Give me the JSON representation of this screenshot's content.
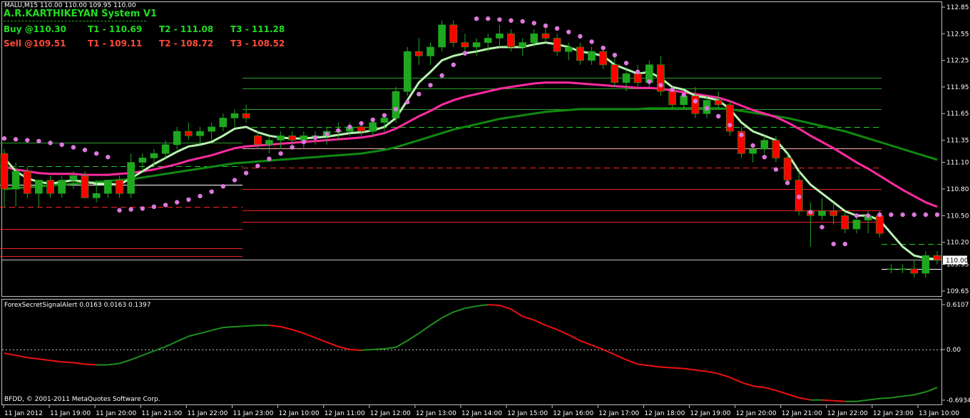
{
  "header": {
    "symbol_line": "MALU,M15  110.00 110.00 109.95 110.00",
    "system_name": "A.R.KARTHIKEYAN System V1",
    "buy": {
      "entry": "Buy @110.30",
      "t1": "T1 - 110.69",
      "t2": "T2 - 111.08",
      "t3": "T3 - 111.28"
    },
    "sell": {
      "entry": "Sell @109.51",
      "t1": "T1 - 109.11",
      "t2": "T2 - 108.72",
      "t3": "T3 - 108.52"
    }
  },
  "indicator": {
    "label": "ForexSecretSignalAlert 0.0163 0.0163 0.1397"
  },
  "copyright": "BFDD, © 2001-2011 MetaQuotes Software Corp.",
  "colors": {
    "bull": "#1fa81f",
    "bear": "#ff0000",
    "ema_fast": "#b8f5b0",
    "ema_mid": "#ff2ba0",
    "ema_slow": "#0f8a0f",
    "psar": "#dd77dd"
  },
  "chart_data": {
    "type": "line",
    "price_axis": [
      "112.85",
      "112.55",
      "112.25",
      "111.95",
      "111.65",
      "111.35",
      "111.10",
      "110.80",
      "110.50",
      "110.20",
      "109.95",
      "109.65"
    ],
    "price_values": [
      112.85,
      112.55,
      112.25,
      111.95,
      111.65,
      111.35,
      111.1,
      110.8,
      110.5,
      110.2,
      109.95,
      109.65
    ],
    "current_price": "110.00",
    "ylim": [
      109.55,
      112.92
    ],
    "time_axis": [
      "11 Jan 2012",
      "11 Jan 19:00",
      "11 Jan 20:00",
      "11 Jan 21:00",
      "11 Jan 22:00",
      "11 Jan 23:00",
      "12 Jan 10:00",
      "12 Jan 11:00",
      "12 Jan 12:00",
      "12 Jan 13:00",
      "12 Jan 14:00",
      "12 Jan 15:00",
      "12 Jan 16:00",
      "12 Jan 17:00",
      "12 Jan 18:00",
      "12 Jan 19:00",
      "12 Jan 20:00",
      "12 Jan 21:00",
      "12 Jan 22:00",
      "12 Jan 23:00",
      "13 Jan 10:00"
    ],
    "indicator_axis": [
      "0.6107",
      "0.00",
      "-0.6934"
    ],
    "indicator_values": [
      0.6107,
      0.0,
      -0.6934
    ],
    "candles": [
      [
        111.2,
        111.25,
        110.6,
        110.8
      ],
      [
        110.8,
        111.1,
        110.6,
        111.0
      ],
      [
        111.0,
        111.05,
        110.7,
        110.75
      ],
      [
        110.75,
        110.9,
        110.6,
        110.9
      ],
      [
        110.9,
        110.95,
        110.7,
        110.75
      ],
      [
        110.75,
        110.95,
        110.7,
        110.9
      ],
      [
        110.9,
        111.0,
        110.8,
        110.95
      ],
      [
        110.95,
        111.0,
        110.7,
        110.7
      ],
      [
        110.7,
        110.9,
        110.65,
        110.75
      ],
      [
        110.75,
        110.9,
        110.7,
        110.9
      ],
      [
        110.9,
        110.95,
        110.7,
        110.75
      ],
      [
        110.75,
        111.2,
        110.7,
        111.1
      ],
      [
        111.1,
        111.2,
        111.0,
        111.15
      ],
      [
        111.15,
        111.25,
        111.05,
        111.2
      ],
      [
        111.2,
        111.35,
        111.15,
        111.3
      ],
      [
        111.3,
        111.5,
        111.25,
        111.45
      ],
      [
        111.45,
        111.55,
        111.35,
        111.4
      ],
      [
        111.4,
        111.5,
        111.3,
        111.45
      ],
      [
        111.45,
        111.55,
        111.35,
        111.5
      ],
      [
        111.5,
        111.65,
        111.45,
        111.6
      ],
      [
        111.6,
        111.7,
        111.5,
        111.65
      ],
      [
        111.65,
        111.75,
        111.55,
        111.6
      ],
      [
        111.4,
        111.45,
        111.25,
        111.3
      ],
      [
        111.3,
        111.4,
        111.2,
        111.35
      ],
      [
        111.35,
        111.45,
        111.25,
        111.4
      ],
      [
        111.4,
        111.45,
        111.3,
        111.35
      ],
      [
        111.35,
        111.45,
        111.25,
        111.4
      ],
      [
        111.4,
        111.45,
        111.3,
        111.4
      ],
      [
        111.4,
        111.5,
        111.3,
        111.45
      ],
      [
        111.45,
        111.55,
        111.35,
        111.45
      ],
      [
        111.45,
        111.55,
        111.4,
        111.5
      ],
      [
        111.5,
        111.55,
        111.4,
        111.45
      ],
      [
        111.45,
        111.6,
        111.4,
        111.55
      ],
      [
        111.55,
        111.65,
        111.45,
        111.6
      ],
      [
        111.6,
        111.95,
        111.55,
        111.9
      ],
      [
        111.9,
        112.4,
        111.85,
        112.35
      ],
      [
        112.35,
        112.5,
        112.2,
        112.3
      ],
      [
        112.3,
        112.45,
        112.2,
        112.4
      ],
      [
        112.4,
        112.7,
        112.35,
        112.65
      ],
      [
        112.65,
        112.7,
        112.4,
        112.45
      ],
      [
        112.45,
        112.55,
        112.3,
        112.4
      ],
      [
        112.4,
        112.5,
        112.3,
        112.45
      ],
      [
        112.45,
        112.55,
        112.35,
        112.5
      ],
      [
        112.5,
        112.65,
        112.4,
        112.55
      ],
      [
        112.55,
        112.6,
        112.35,
        112.4
      ],
      [
        112.4,
        112.5,
        112.3,
        112.45
      ],
      [
        112.45,
        112.6,
        112.4,
        112.55
      ],
      [
        112.55,
        112.65,
        112.45,
        112.5
      ],
      [
        112.5,
        112.55,
        112.3,
        112.35
      ],
      [
        112.35,
        112.45,
        112.25,
        112.4
      ],
      [
        112.4,
        112.45,
        112.2,
        112.25
      ],
      [
        112.25,
        112.4,
        112.2,
        112.35
      ],
      [
        112.35,
        112.4,
        112.15,
        112.2
      ],
      [
        112.2,
        112.3,
        111.95,
        112.0
      ],
      [
        112.0,
        112.15,
        111.9,
        112.1
      ],
      [
        112.1,
        112.2,
        111.95,
        112.0
      ],
      [
        112.0,
        112.25,
        111.95,
        112.2
      ],
      [
        112.2,
        112.3,
        111.85,
        111.9
      ],
      [
        111.9,
        111.95,
        111.7,
        111.75
      ],
      [
        111.75,
        111.9,
        111.7,
        111.85
      ],
      [
        111.85,
        111.95,
        111.6,
        111.65
      ],
      [
        111.65,
        111.85,
        111.6,
        111.8
      ],
      [
        111.8,
        111.9,
        111.7,
        111.75
      ],
      [
        111.75,
        111.8,
        111.4,
        111.45
      ],
      [
        111.45,
        111.5,
        111.15,
        111.2
      ],
      [
        111.2,
        111.3,
        111.1,
        111.25
      ],
      [
        111.25,
        111.4,
        111.2,
        111.35
      ],
      [
        111.35,
        111.4,
        111.1,
        111.15
      ],
      [
        111.15,
        111.2,
        110.85,
        110.9
      ],
      [
        110.9,
        111.0,
        110.5,
        110.55
      ],
      [
        110.55,
        110.65,
        110.15,
        110.5
      ],
      [
        110.5,
        110.7,
        110.45,
        110.55
      ],
      [
        110.55,
        110.65,
        110.4,
        110.5
      ],
      [
        110.5,
        110.55,
        110.3,
        110.35
      ],
      [
        110.35,
        110.5,
        110.3,
        110.45
      ],
      [
        110.45,
        110.55,
        110.3,
        110.5
      ],
      [
        110.5,
        110.55,
        110.25,
        110.3
      ],
      [
        109.9,
        109.95,
        109.85,
        109.9
      ],
      [
        109.9,
        109.95,
        109.85,
        109.9
      ],
      [
        109.9,
        110.0,
        109.8,
        109.85
      ],
      [
        109.85,
        110.1,
        109.8,
        110.05
      ],
      [
        110.05,
        110.1,
        109.95,
        110.0
      ]
    ],
    "ema_fast": [
      111.15,
      111.0,
      110.92,
      110.88,
      110.86,
      110.88,
      110.9,
      110.88,
      110.86,
      110.86,
      110.85,
      110.92,
      111.0,
      111.08,
      111.15,
      111.22,
      111.28,
      111.3,
      111.33,
      111.4,
      111.48,
      111.5,
      111.44,
      111.4,
      111.38,
      111.37,
      111.37,
      111.38,
      111.39,
      111.41,
      111.43,
      111.44,
      111.46,
      111.5,
      111.6,
      111.8,
      112.0,
      112.12,
      112.25,
      112.3,
      112.33,
      112.35,
      112.38,
      112.4,
      112.4,
      112.4,
      112.43,
      112.45,
      112.43,
      112.4,
      112.35,
      112.33,
      112.3,
      112.2,
      112.15,
      112.1,
      112.12,
      112.05,
      111.95,
      111.92,
      111.85,
      111.83,
      111.8,
      111.7,
      111.55,
      111.45,
      111.4,
      111.35,
      111.2,
      111.0,
      110.85,
      110.75,
      110.65,
      110.55,
      110.5,
      110.5,
      110.45,
      110.3,
      110.15,
      110.05,
      110.02,
      110.01
    ],
    "ema_mid": [
      111.05,
      111.02,
      111.0,
      110.98,
      110.97,
      110.97,
      110.97,
      110.96,
      110.96,
      110.96,
      110.97,
      110.98,
      111.0,
      111.02,
      111.05,
      111.08,
      111.12,
      111.15,
      111.18,
      111.22,
      111.26,
      111.28,
      111.29,
      111.3,
      111.31,
      111.32,
      111.33,
      111.34,
      111.35,
      111.36,
      111.37,
      111.38,
      111.4,
      111.43,
      111.48,
      111.55,
      111.62,
      111.68,
      111.75,
      111.8,
      111.84,
      111.87,
      111.9,
      111.93,
      111.95,
      111.97,
      111.99,
      112.0,
      112.0,
      112.0,
      111.99,
      111.98,
      111.97,
      111.96,
      111.95,
      111.94,
      111.94,
      111.93,
      111.91,
      111.89,
      111.87,
      111.85,
      111.83,
      111.79,
      111.74,
      111.69,
      111.65,
      111.61,
      111.55,
      111.48,
      111.4,
      111.33,
      111.26,
      111.18,
      111.1,
      111.03,
      110.95,
      110.87,
      110.79,
      110.72,
      110.65,
      110.6
    ],
    "ema_slow": [
      110.8,
      110.81,
      110.82,
      110.83,
      110.84,
      110.85,
      110.86,
      110.87,
      110.88,
      110.89,
      110.9,
      110.91,
      110.93,
      110.95,
      110.97,
      110.99,
      111.01,
      111.03,
      111.05,
      111.07,
      111.09,
      111.1,
      111.11,
      111.12,
      111.13,
      111.14,
      111.15,
      111.16,
      111.17,
      111.18,
      111.19,
      111.2,
      111.22,
      111.24,
      111.27,
      111.31,
      111.35,
      111.39,
      111.43,
      111.47,
      111.5,
      111.53,
      111.56,
      111.59,
      111.61,
      111.63,
      111.65,
      111.67,
      111.68,
      111.69,
      111.7,
      111.7,
      111.7,
      111.7,
      111.7,
      111.7,
      111.71,
      111.71,
      111.71,
      111.71,
      111.71,
      111.71,
      111.71,
      111.7,
      111.68,
      111.66,
      111.64,
      111.62,
      111.6,
      111.57,
      111.54,
      111.51,
      111.48,
      111.45,
      111.41,
      111.37,
      111.33,
      111.29,
      111.25,
      111.21,
      111.17,
      111.13
    ],
    "psar": [
      111.37,
      111.36,
      111.35,
      111.34,
      111.32,
      111.3,
      111.27,
      111.24,
      111.2,
      111.16,
      110.56,
      110.57,
      110.58,
      110.6,
      110.62,
      110.65,
      110.68,
      110.72,
      110.77,
      110.83,
      110.9,
      110.98,
      111.06,
      111.14,
      111.2,
      111.27,
      111.33,
      111.38,
      111.42,
      111.46,
      111.5,
      111.54,
      111.58,
      111.63,
      111.7,
      111.78,
      111.87,
      111.97,
      112.08,
      112.2,
      112.33,
      112.72,
      112.72,
      112.71,
      112.7,
      112.69,
      112.67,
      112.64,
      112.61,
      112.57,
      112.52,
      112.46,
      112.39,
      112.31,
      112.22,
      112.12,
      112.01,
      111.97,
      111.92,
      111.86,
      111.79,
      111.71,
      111.62,
      111.52,
      111.41,
      111.29,
      111.16,
      111.02,
      110.87,
      110.71,
      110.54,
      110.37,
      110.18,
      110.18,
      110.5,
      110.5,
      110.51,
      110.51,
      110.51,
      110.51,
      110.51,
      110.51
    ],
    "indicator_series": [
      -0.05,
      -0.08,
      -0.11,
      -0.13,
      -0.15,
      -0.17,
      -0.18,
      -0.2,
      -0.21,
      -0.21,
      -0.19,
      -0.14,
      -0.08,
      -0.02,
      0.04,
      0.11,
      0.18,
      0.22,
      0.26,
      0.3,
      0.31,
      0.32,
      0.33,
      0.33,
      0.31,
      0.27,
      0.22,
      0.16,
      0.1,
      0.04,
      0.0,
      -0.01,
      0.0,
      0.01,
      0.03,
      0.12,
      0.22,
      0.33,
      0.43,
      0.51,
      0.56,
      0.59,
      0.61,
      0.6,
      0.55,
      0.45,
      0.4,
      0.33,
      0.27,
      0.2,
      0.12,
      0.06,
      0.0,
      -0.07,
      -0.14,
      -0.2,
      -0.22,
      -0.24,
      -0.25,
      -0.26,
      -0.28,
      -0.3,
      -0.33,
      -0.38,
      -0.45,
      -0.5,
      -0.52,
      -0.56,
      -0.61,
      -0.66,
      -0.69,
      -0.69,
      -0.7,
      -0.71,
      -0.71,
      -0.69,
      -0.67,
      -0.66,
      -0.64,
      -0.62,
      -0.58,
      -0.52
    ],
    "levels": [
      {
        "price": 112.05,
        "color": "#2e9e2e",
        "style": "solid",
        "from": "mid"
      },
      {
        "price": 111.93,
        "color": "#2e9e2e",
        "style": "solid",
        "from": "mid"
      },
      {
        "price": 111.7,
        "color": "#2e9e2e",
        "style": "solid",
        "from": "mid"
      },
      {
        "price": 111.5,
        "color": "#22cc22",
        "style": "dash",
        "from": "mid"
      },
      {
        "price": 111.26,
        "color": "#ffb0b0",
        "style": "solid",
        "from": "mid"
      },
      {
        "price": 111.04,
        "color": "#ff2222",
        "style": "dash",
        "from": "mid"
      },
      {
        "price": 110.8,
        "color": "#ee2222",
        "style": "solid",
        "from": "mid"
      },
      {
        "price": 110.56,
        "color": "#ee2222",
        "style": "solid",
        "from": "mid"
      },
      {
        "price": 110.43,
        "color": "#ee2222",
        "style": "solid",
        "from": "mid"
      },
      {
        "price": 111.32,
        "color": "#2e9e2e",
        "style": "solid",
        "from": "left"
      },
      {
        "price": 111.06,
        "color": "#22cc22",
        "style": "dash",
        "from": "left"
      },
      {
        "price": 110.85,
        "color": "#ffffff",
        "style": "solid",
        "from": "left"
      },
      {
        "price": 110.6,
        "color": "#ff2222",
        "style": "dash",
        "from": "left"
      },
      {
        "price": 110.35,
        "color": "#ee2222",
        "style": "solid",
        "from": "left"
      },
      {
        "price": 110.13,
        "color": "#ee2222",
        "style": "solid",
        "from": "left"
      },
      {
        "price": 110.04,
        "color": "#ee2222",
        "style": "solid",
        "from": "left"
      },
      {
        "price": 110.18,
        "color": "#22cc22",
        "style": "dash",
        "from": "right"
      },
      {
        "price": 109.9,
        "color": "#ffffff",
        "style": "solid",
        "from": "right"
      },
      {
        "price": 110.0,
        "color": "#c0c0c0",
        "style": "solid",
        "from": "all"
      }
    ]
  }
}
